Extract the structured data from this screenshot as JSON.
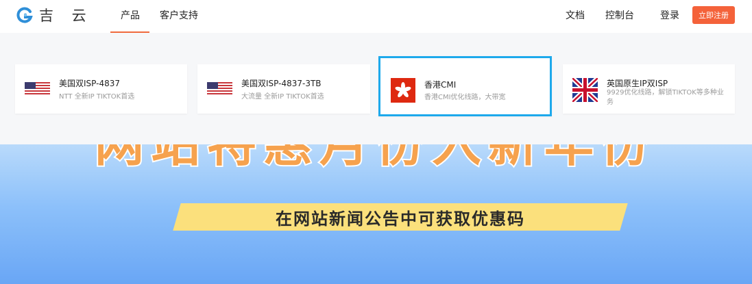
{
  "header": {
    "logo_text": "吉 云",
    "nav": {
      "products": "产品",
      "support": "客户支持"
    },
    "right": {
      "docs": "文档",
      "console": "控制台",
      "login": "登录",
      "register": "立即注册"
    }
  },
  "products": [
    {
      "flag": "us-flag-icon",
      "title": "美国双ISP-4837",
      "desc": "NTT 全新IP TIKTOK首选"
    },
    {
      "flag": "us-flag-icon",
      "title": "美国双ISP-4837-3TB",
      "desc": "大流量 全新IP TIKTOK首选"
    },
    {
      "flag": "hk-flag-icon",
      "title": "香港CMI",
      "desc": "香港CMI优化线路，大带宽"
    },
    {
      "flag": "uk-flag-icon",
      "title": "英国原生IP双ISP",
      "desc": "9929优化线路，解锁TIKTOK等多种业务"
    }
  ],
  "banner": {
    "slogan": "网站特惠月份入新年份",
    "promo": "在网站新闻公告中可获取优惠码"
  },
  "colors": {
    "accent": "#f4623a",
    "highlight": "#1da9ec",
    "promo_bg": "#fbe07c"
  }
}
